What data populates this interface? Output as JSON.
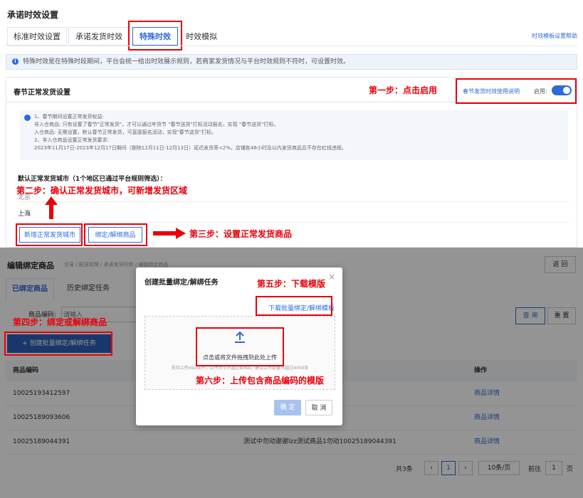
{
  "top": {
    "page_title": "承诺时效设置",
    "tabs": [
      "标准时效设置",
      "承诺发货时效",
      "特殊时效",
      "时效模拟"
    ],
    "help_link": "时效模板设置帮助",
    "notice": "特殊时效是在特殊时段期间，平台会统一给出时效展示规则，若商家发货情况与平台时效规则不符时，可设置时效。",
    "section_title": "春节正常发货设置",
    "step1": "第一步：点击启用",
    "desc_link": "春节发货时效使用说明",
    "enable_label": "启用:",
    "rules": [
      "1、春节期间设置正常发货权益:",
      "非入仓商品: 只有设置了春节\"正常发货\"，才可以通过年货节 \"春节送货\"打标活动报名，实现 \"春节送货\"打标。",
      "入仓商品: 无需设置，默认春节正常发货，可直接报名活动，实现\"春节送货\"打标。",
      "2、非入仓商品设置正常发货要求:",
      "2023年11月17日-2023年12月17日期间（剔除12月11日-12月13日）延迟发货率<2%，店铺各48小时及以内发货商品且不存在红线违规。"
    ],
    "default_cities": "默认正常发货城市（1个地区已通过平台规则筛选）：",
    "step2": "第二步：确认正常发货城市，可新增发货区域",
    "city_partial": "北京",
    "city_shanghai": "上海",
    "add_city_btn": "新增正常发货城市",
    "bind_btn": "绑定/解绑商品",
    "step3": "第三步：设置正常发货商品"
  },
  "bottom": {
    "page_title": "编辑绑定商品",
    "breadcrumb": [
      "交易",
      "配送管理",
      "承诺发货时效",
      "编辑绑定商品"
    ],
    "back_btn": "返 回",
    "tabs": [
      "已绑定商品",
      "历史绑定任务"
    ],
    "code_label": "商品编码:",
    "code_placeholder": "请输入",
    "query_btn": "查 询",
    "reset_btn": "重 置",
    "step4": "第四步：绑定或解绑商品",
    "create_btn": "+ 创建批量绑定/解绑任务",
    "col_code": "商品编码",
    "col_action": "操作",
    "rows": [
      {
        "code": "10025193412597",
        "name": "",
        "action": "商品详情"
      },
      {
        "code": "10025189093606",
        "name": "",
        "action": "商品详情"
      },
      {
        "code": "10025189044391",
        "name": "测试中勿动谢谢lzz测试商品1勿动10025189044391",
        "action": "商品详情"
      }
    ],
    "total": "共3条",
    "page_num": "1",
    "page_size": "10条/页",
    "goto_label": "前往",
    "goto_value": "1",
    "page_unit": "页"
  },
  "modal": {
    "title": "创建批量绑定/解绑任务",
    "close": "×",
    "step5": "第五步：下载模版",
    "download_link": "下载批量绑定/解绑模板",
    "upload_text": "点击或将文件拖拽到此处上传",
    "upload_hint": "支持上传xlsx文件，文件大小不超过80KB，建议上传数量不超过4000条",
    "step6": "第六步：上传包含商品编码的模版",
    "ok_btn": "确 定",
    "cancel_btn": "取 消"
  }
}
